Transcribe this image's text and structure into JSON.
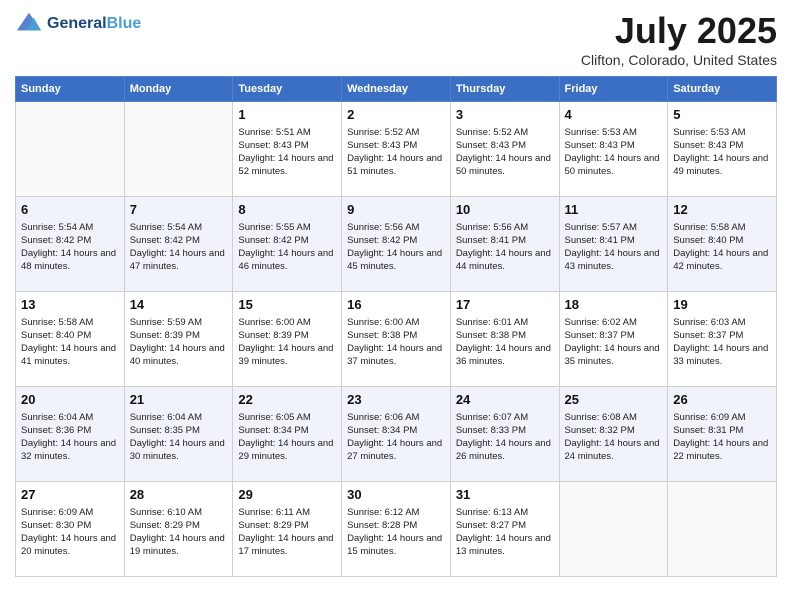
{
  "header": {
    "logo_line1": "General",
    "logo_line2": "Blue",
    "month_title": "July 2025",
    "location": "Clifton, Colorado, United States"
  },
  "days_of_week": [
    "Sunday",
    "Monday",
    "Tuesday",
    "Wednesday",
    "Thursday",
    "Friday",
    "Saturday"
  ],
  "weeks": [
    [
      {
        "day": "",
        "data": ""
      },
      {
        "day": "",
        "data": ""
      },
      {
        "day": "1",
        "sunrise": "Sunrise: 5:51 AM",
        "sunset": "Sunset: 8:43 PM",
        "daylight": "Daylight: 14 hours and 52 minutes."
      },
      {
        "day": "2",
        "sunrise": "Sunrise: 5:52 AM",
        "sunset": "Sunset: 8:43 PM",
        "daylight": "Daylight: 14 hours and 51 minutes."
      },
      {
        "day": "3",
        "sunrise": "Sunrise: 5:52 AM",
        "sunset": "Sunset: 8:43 PM",
        "daylight": "Daylight: 14 hours and 50 minutes."
      },
      {
        "day": "4",
        "sunrise": "Sunrise: 5:53 AM",
        "sunset": "Sunset: 8:43 PM",
        "daylight": "Daylight: 14 hours and 50 minutes."
      },
      {
        "day": "5",
        "sunrise": "Sunrise: 5:53 AM",
        "sunset": "Sunset: 8:43 PM",
        "daylight": "Daylight: 14 hours and 49 minutes."
      }
    ],
    [
      {
        "day": "6",
        "sunrise": "Sunrise: 5:54 AM",
        "sunset": "Sunset: 8:42 PM",
        "daylight": "Daylight: 14 hours and 48 minutes."
      },
      {
        "day": "7",
        "sunrise": "Sunrise: 5:54 AM",
        "sunset": "Sunset: 8:42 PM",
        "daylight": "Daylight: 14 hours and 47 minutes."
      },
      {
        "day": "8",
        "sunrise": "Sunrise: 5:55 AM",
        "sunset": "Sunset: 8:42 PM",
        "daylight": "Daylight: 14 hours and 46 minutes."
      },
      {
        "day": "9",
        "sunrise": "Sunrise: 5:56 AM",
        "sunset": "Sunset: 8:42 PM",
        "daylight": "Daylight: 14 hours and 45 minutes."
      },
      {
        "day": "10",
        "sunrise": "Sunrise: 5:56 AM",
        "sunset": "Sunset: 8:41 PM",
        "daylight": "Daylight: 14 hours and 44 minutes."
      },
      {
        "day": "11",
        "sunrise": "Sunrise: 5:57 AM",
        "sunset": "Sunset: 8:41 PM",
        "daylight": "Daylight: 14 hours and 43 minutes."
      },
      {
        "day": "12",
        "sunrise": "Sunrise: 5:58 AM",
        "sunset": "Sunset: 8:40 PM",
        "daylight": "Daylight: 14 hours and 42 minutes."
      }
    ],
    [
      {
        "day": "13",
        "sunrise": "Sunrise: 5:58 AM",
        "sunset": "Sunset: 8:40 PM",
        "daylight": "Daylight: 14 hours and 41 minutes."
      },
      {
        "day": "14",
        "sunrise": "Sunrise: 5:59 AM",
        "sunset": "Sunset: 8:39 PM",
        "daylight": "Daylight: 14 hours and 40 minutes."
      },
      {
        "day": "15",
        "sunrise": "Sunrise: 6:00 AM",
        "sunset": "Sunset: 8:39 PM",
        "daylight": "Daylight: 14 hours and 39 minutes."
      },
      {
        "day": "16",
        "sunrise": "Sunrise: 6:00 AM",
        "sunset": "Sunset: 8:38 PM",
        "daylight": "Daylight: 14 hours and 37 minutes."
      },
      {
        "day": "17",
        "sunrise": "Sunrise: 6:01 AM",
        "sunset": "Sunset: 8:38 PM",
        "daylight": "Daylight: 14 hours and 36 minutes."
      },
      {
        "day": "18",
        "sunrise": "Sunrise: 6:02 AM",
        "sunset": "Sunset: 8:37 PM",
        "daylight": "Daylight: 14 hours and 35 minutes."
      },
      {
        "day": "19",
        "sunrise": "Sunrise: 6:03 AM",
        "sunset": "Sunset: 8:37 PM",
        "daylight": "Daylight: 14 hours and 33 minutes."
      }
    ],
    [
      {
        "day": "20",
        "sunrise": "Sunrise: 6:04 AM",
        "sunset": "Sunset: 8:36 PM",
        "daylight": "Daylight: 14 hours and 32 minutes."
      },
      {
        "day": "21",
        "sunrise": "Sunrise: 6:04 AM",
        "sunset": "Sunset: 8:35 PM",
        "daylight": "Daylight: 14 hours and 30 minutes."
      },
      {
        "day": "22",
        "sunrise": "Sunrise: 6:05 AM",
        "sunset": "Sunset: 8:34 PM",
        "daylight": "Daylight: 14 hours and 29 minutes."
      },
      {
        "day": "23",
        "sunrise": "Sunrise: 6:06 AM",
        "sunset": "Sunset: 8:34 PM",
        "daylight": "Daylight: 14 hours and 27 minutes."
      },
      {
        "day": "24",
        "sunrise": "Sunrise: 6:07 AM",
        "sunset": "Sunset: 8:33 PM",
        "daylight": "Daylight: 14 hours and 26 minutes."
      },
      {
        "day": "25",
        "sunrise": "Sunrise: 6:08 AM",
        "sunset": "Sunset: 8:32 PM",
        "daylight": "Daylight: 14 hours and 24 minutes."
      },
      {
        "day": "26",
        "sunrise": "Sunrise: 6:09 AM",
        "sunset": "Sunset: 8:31 PM",
        "daylight": "Daylight: 14 hours and 22 minutes."
      }
    ],
    [
      {
        "day": "27",
        "sunrise": "Sunrise: 6:09 AM",
        "sunset": "Sunset: 8:30 PM",
        "daylight": "Daylight: 14 hours and 20 minutes."
      },
      {
        "day": "28",
        "sunrise": "Sunrise: 6:10 AM",
        "sunset": "Sunset: 8:29 PM",
        "daylight": "Daylight: 14 hours and 19 minutes."
      },
      {
        "day": "29",
        "sunrise": "Sunrise: 6:11 AM",
        "sunset": "Sunset: 8:29 PM",
        "daylight": "Daylight: 14 hours and 17 minutes."
      },
      {
        "day": "30",
        "sunrise": "Sunrise: 6:12 AM",
        "sunset": "Sunset: 8:28 PM",
        "daylight": "Daylight: 14 hours and 15 minutes."
      },
      {
        "day": "31",
        "sunrise": "Sunrise: 6:13 AM",
        "sunset": "Sunset: 8:27 PM",
        "daylight": "Daylight: 14 hours and 13 minutes."
      },
      {
        "day": "",
        "data": ""
      },
      {
        "day": "",
        "data": ""
      }
    ]
  ]
}
